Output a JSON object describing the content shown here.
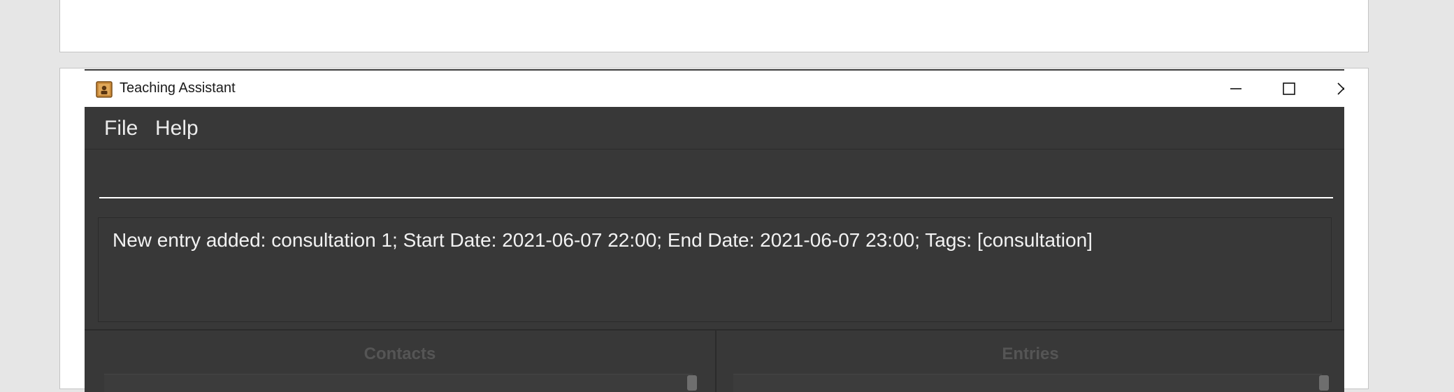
{
  "window": {
    "title": "Teaching Assistant",
    "icon": "app-icon",
    "controls": [
      "minimize-icon",
      "maximize-icon",
      "close-icon"
    ]
  },
  "menubar": {
    "items": [
      {
        "label": "File"
      },
      {
        "label": "Help"
      }
    ]
  },
  "command": {
    "value": "",
    "placeholder": ""
  },
  "result": {
    "message": "New entry added: consultation 1; Start Date: 2021-06-07 22:00; End Date: 2021-06-07 23:00; Tags: [consultation]"
  },
  "panels": {
    "contacts_title": "Contacts",
    "entries_title": "Entries"
  },
  "colors": {
    "background": "#383838",
    "panel_title": "#555555",
    "text": "#f2f2f2",
    "titlebar": "#ffffff"
  }
}
